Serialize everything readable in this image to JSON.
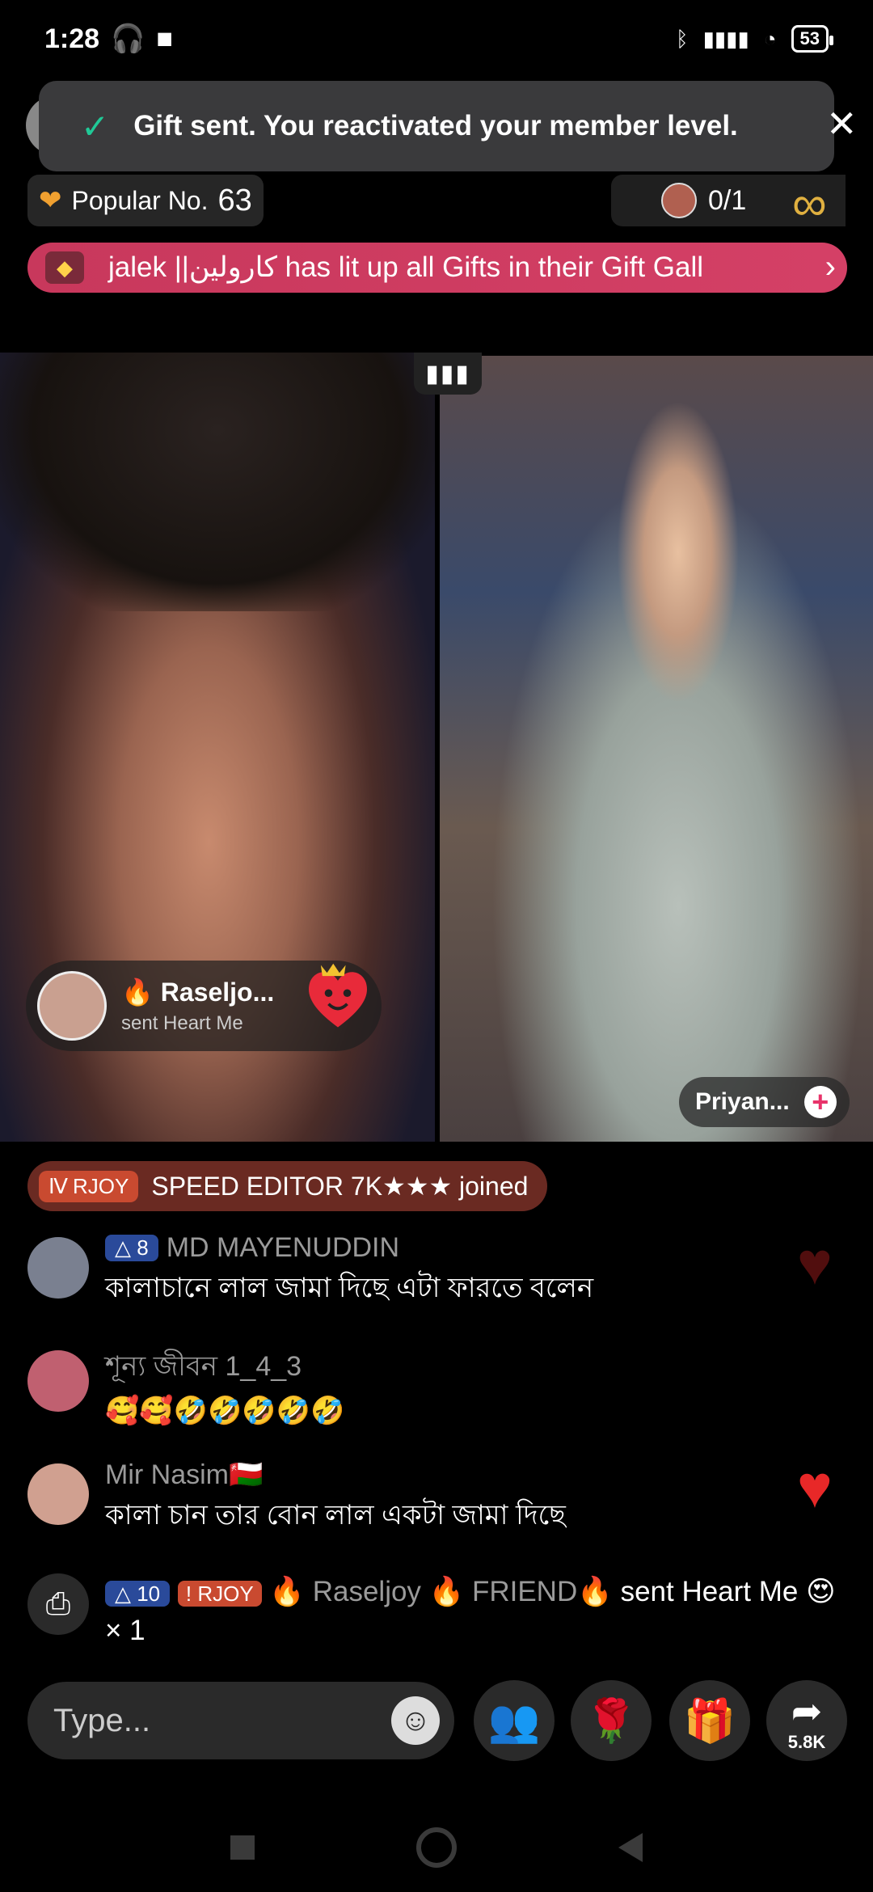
{
  "status_bar": {
    "time": "1:28",
    "battery": "53"
  },
  "toast": {
    "text": "Gift sent. You reactivated your member level."
  },
  "popular": {
    "label": "Popular No.",
    "number": "63"
  },
  "viewers": {
    "count": "0/1"
  },
  "banner": {
    "text": "jalek ||کارولین has lit up all Gifts in their Gift Gall"
  },
  "video": {
    "signal_icon": "signal-bars-icon",
    "gift_notice": {
      "name": "Raseljo...",
      "subtitle": "sent Heart Me"
    },
    "cohost_name": "Priyan..."
  },
  "joined": {
    "badge": "RJOY",
    "text": "SPEED EDITOR 7K★★★ joined"
  },
  "comments": [
    {
      "level": "8",
      "name": "MD MAYENUDDIN",
      "text": "কালাচানে লাল জামা দিছে এটা ফারতে বলেন",
      "avatar_color": "#7a8090"
    },
    {
      "level": "",
      "name": "শূন্য জীবন 1_4_3",
      "text": "🥰🥰🤣🤣🤣🤣🤣",
      "avatar_color": "#c06070"
    },
    {
      "level": "",
      "name": "Mir Nasim🇴🇲",
      "text": "কালা চান তার বোন লাল একটা জামা দিছে",
      "avatar_color": "#d0a090"
    }
  ],
  "gift_line": {
    "level": "10",
    "badge": "RJOY",
    "sender": "🔥 Raseljoy 🔥 FRIEND🔥",
    "action": "sent Heart Me",
    "count": "× 1"
  },
  "bottom": {
    "placeholder": "Type...",
    "share_count": "5.8K"
  },
  "colors": {
    "accent_pink": "#e8336a",
    "gold": "#e0b040",
    "banner": "#c8385c"
  }
}
